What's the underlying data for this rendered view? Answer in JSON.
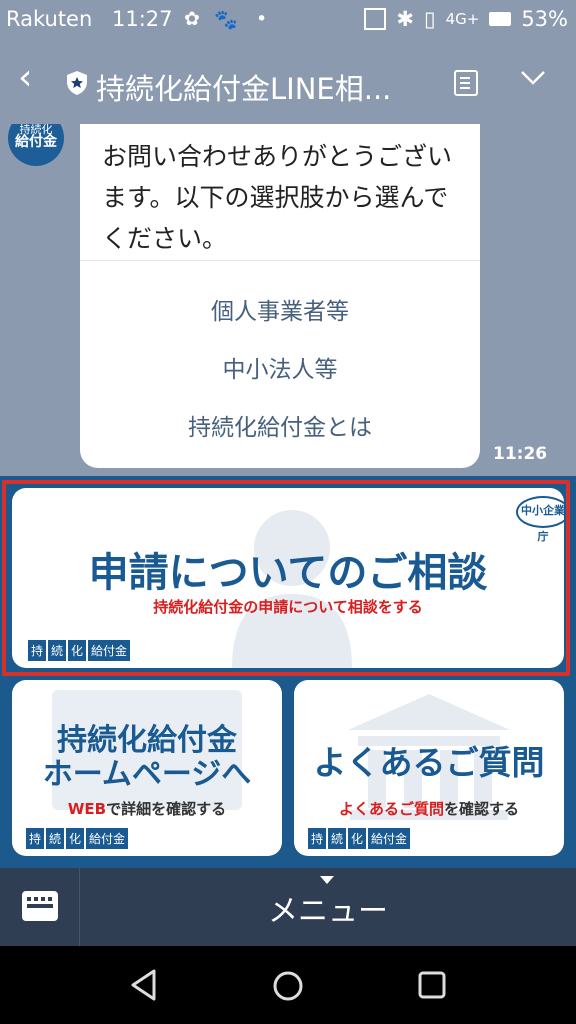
{
  "status": {
    "carrier": "Rakuten",
    "time": "11:27",
    "network": "4G+",
    "battery": "53%"
  },
  "header": {
    "title": "持続化給付金LINE相..."
  },
  "chat": {
    "avatar_top": "持続化",
    "avatar_main": "給付金",
    "message": "お問い合わせありがとうございます。以下の選択肢から選んでください。",
    "options": [
      "個人事業者等",
      "中小法人等",
      "持続化給付金とは"
    ],
    "timestamp": "11:26"
  },
  "rich_menu": {
    "consult": {
      "title": "申請についてのご相談",
      "subtitle": "持続化給付金の申請について相談をする",
      "agency": "中小企業庁"
    },
    "homepage": {
      "title_line1": "持続化給付金",
      "title_line2": "ホームページへ",
      "subtitle_red": "WEB",
      "subtitle_rest": "で詳細を確認する"
    },
    "faq": {
      "title": "よくあるご質問",
      "subtitle_red": "よくあるご質問",
      "subtitle_rest": "を確認する"
    },
    "logo": [
      "持",
      "続",
      "化",
      "給付金"
    ]
  },
  "menubar": {
    "label": "メニュー"
  },
  "colors": {
    "accent_blue": "#1a5a92",
    "highlight_red": "#d8302a"
  }
}
